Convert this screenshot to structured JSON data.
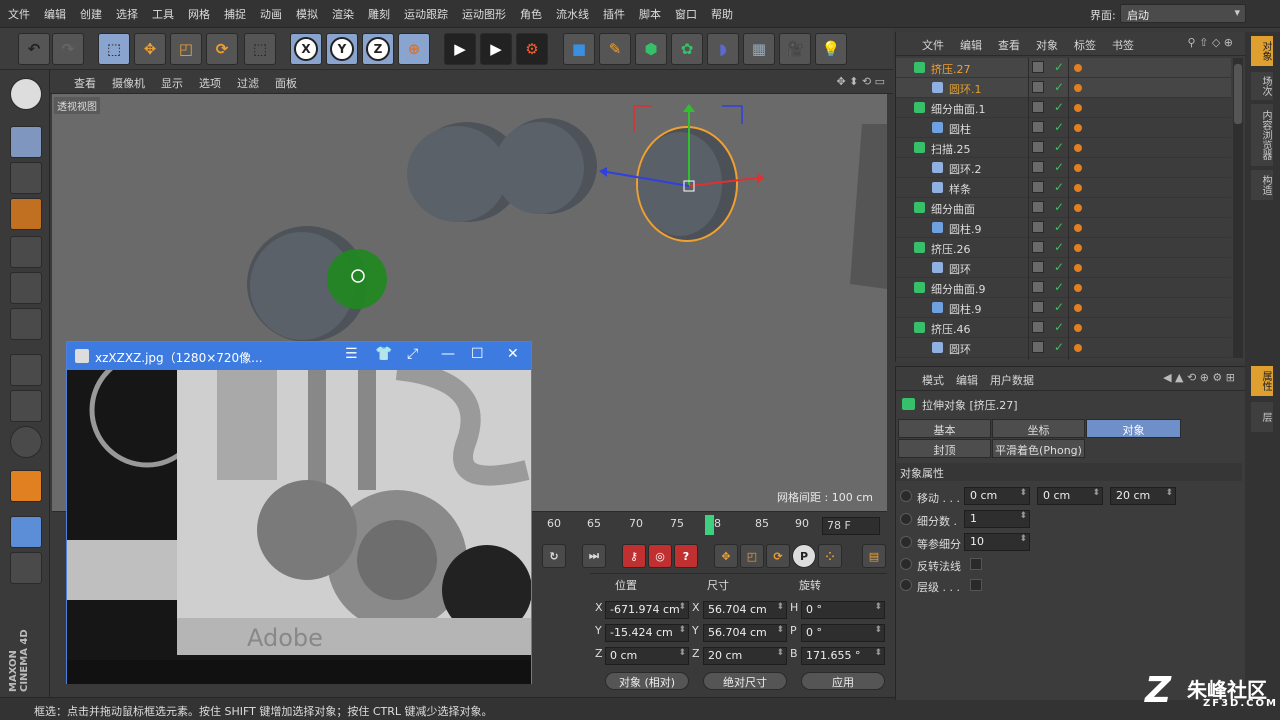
{
  "menu": {
    "items": [
      "文件",
      "编辑",
      "创建",
      "选择",
      "工具",
      "网格",
      "捕捉",
      "动画",
      "模拟",
      "渲染",
      "雕刻",
      "运动跟踪",
      "运动图形",
      "角色",
      "流水线",
      "插件",
      "脚本",
      "窗口",
      "帮助"
    ],
    "layout_label": "界面:",
    "layout_value": "启动"
  },
  "toolbar": {
    "axis_x": "X",
    "axis_y": "Y",
    "axis_z": "Z"
  },
  "viewport": {
    "menu": [
      "查看",
      "摄像机",
      "显示",
      "选项",
      "过滤",
      "面板"
    ],
    "label": "透视视图",
    "grid_distance": "网格间距 : 100 cm"
  },
  "timeline": {
    "ticks": [
      "60",
      "65",
      "70",
      "75",
      "78",
      "85",
      "90"
    ],
    "current_frame": "78 F"
  },
  "coords": {
    "headers": [
      "位置",
      "尺寸",
      "旋转"
    ],
    "rows": [
      {
        "a": "X",
        "pos": "-671.974 cm",
        "b": "X",
        "size": "56.704 cm",
        "c": "H",
        "rot": "0 °"
      },
      {
        "a": "Y",
        "pos": "-15.424 cm",
        "b": "Y",
        "size": "56.704 cm",
        "c": "P",
        "rot": "0 °"
      },
      {
        "a": "Z",
        "pos": "0 cm",
        "b": "Z",
        "size": "20 cm",
        "c": "B",
        "rot": "171.655 °"
      }
    ],
    "mode_object": "对象 (相对)",
    "mode_size": "绝对尺寸",
    "apply": "应用"
  },
  "status": "框选：点击并拖动鼠标框选元素。按住 SHIFT 键增加选择对象；按住 CTRL 键减少选择对象。",
  "brand": "MAXON CINEMA 4D",
  "objects": {
    "menu": [
      "文件",
      "编辑",
      "查看",
      "对象",
      "标签",
      "书签"
    ],
    "rows": [
      {
        "name": "挤压.27",
        "indent": 0,
        "color": "#37c06a",
        "selected": true,
        "text_color": "#f0a030"
      },
      {
        "name": "圆环.1",
        "indent": 1,
        "color": "#8fb0e0",
        "selected": true,
        "text_color": "#e0a030"
      },
      {
        "name": "细分曲面.1",
        "indent": 0,
        "color": "#37c06a"
      },
      {
        "name": "圆柱",
        "indent": 1,
        "color": "#6fa0e0"
      },
      {
        "name": "扫描.25",
        "indent": 0,
        "color": "#37c06a"
      },
      {
        "name": "圆环.2",
        "indent": 1,
        "color": "#8fb0e0"
      },
      {
        "name": "样条",
        "indent": 1,
        "color": "#8fb0e0"
      },
      {
        "name": "细分曲面",
        "indent": 0,
        "color": "#37c06a"
      },
      {
        "name": "圆柱.9",
        "indent": 1,
        "color": "#6fa0e0"
      },
      {
        "name": "挤压.26",
        "indent": 0,
        "color": "#37c06a"
      },
      {
        "name": "圆环",
        "indent": 1,
        "color": "#8fb0e0"
      },
      {
        "name": "细分曲面.9",
        "indent": 0,
        "color": "#37c06a"
      },
      {
        "name": "圆柱.9",
        "indent": 1,
        "color": "#6fa0e0"
      },
      {
        "name": "挤压.46",
        "indent": 0,
        "color": "#37c06a"
      },
      {
        "name": "圆环",
        "indent": 1,
        "color": "#8fb0e0"
      }
    ]
  },
  "attributes": {
    "menu": [
      "模式",
      "编辑",
      "用户数据"
    ],
    "title": "拉伸对象 [挤压.27]",
    "tabs": [
      "基本",
      "坐标",
      "对象",
      "封顶",
      "平滑着色(Phong)"
    ],
    "section": "对象属性",
    "move_label": "移动 . . .",
    "move_values": [
      "0 cm",
      "0 cm",
      "20 cm"
    ],
    "subdiv_label": "细分数 .",
    "subdiv_value": "1",
    "iso_label": "等参细分",
    "iso_value": "10",
    "flip_label": "反转法线",
    "hier_label": "层级 . . ."
  },
  "side_tabs": [
    "对象",
    "场次",
    "内容浏览器",
    "构造",
    "属性",
    "层"
  ],
  "image_viewer": {
    "title": "xzXZXZ.jpg（1280×720像...",
    "brand_text": "Adobe"
  },
  "watermark": {
    "main": "朱峰社区",
    "sub": "ZF3D.COM"
  }
}
